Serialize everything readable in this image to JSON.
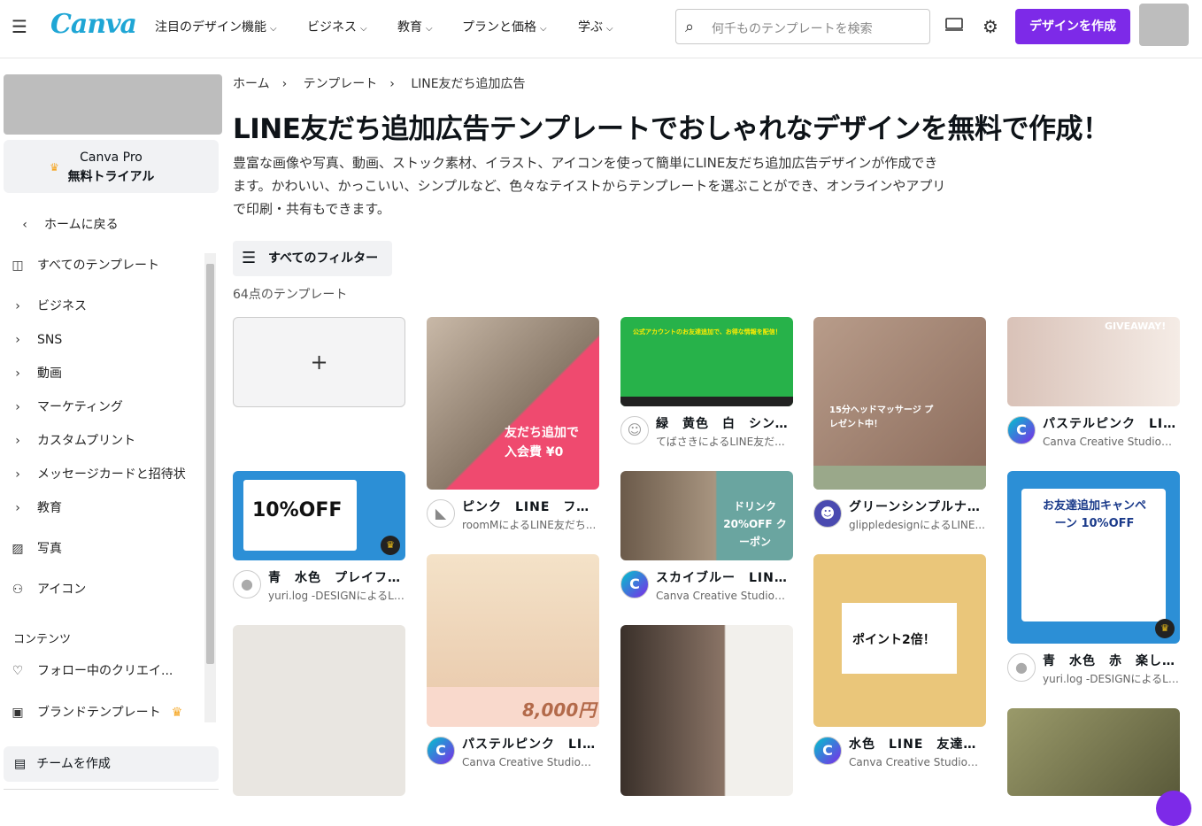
{
  "header": {
    "logo": "Canva",
    "nav": [
      "注目のデザイン機能",
      "ビジネス",
      "教育",
      "プランと価格",
      "学ぶ"
    ],
    "search_placeholder": "何千ものテンプレートを検索",
    "create_label": "デザインを作成"
  },
  "sidebar": {
    "pro_line1": "Canva Pro",
    "pro_line2": "無料トライアル",
    "back": "ホームに戻る",
    "all_templates": "すべてのテンプレート",
    "categories": [
      "ビジネス",
      "SNS",
      "動画",
      "マーケティング",
      "カスタムプリント",
      "メッセージカードと招待状",
      "教育"
    ],
    "photos": "写真",
    "icons": "アイコン",
    "section": "コンテンツ",
    "following": "フォロー中のクリエイ...",
    "brand": "ブランドテンプレート",
    "team": "チームを作成"
  },
  "breadcrumb": [
    "ホーム",
    "テンプレート",
    "LINE友だち追加広告"
  ],
  "page": {
    "title": "LINE友だち追加広告テンプレートでおしゃれなデザインを無料で作成！",
    "description": "豊富な画像や写真、動画、ストック素材、イラスト、アイコンを使って簡単にLINE友だち追加広告デザインが作成できます。かわいい、かっこいい、シンプルなど、色々なテイストからテンプレートを選ぶことができ、オンラインやアプリで印刷・共有もできます。",
    "filter_label": "すべてのフィルター",
    "count": "64点のテンプレート",
    "blank_symbol": "+"
  },
  "templates": [
    {
      "title": "青　水色　プレイフル...",
      "author": "yuri.log -DESIGNによるLI...",
      "thumb_text": "10%OFF"
    },
    {
      "title": "ピンク　LINE　フィッ...",
      "author": "roomMによるLINE友だち...",
      "thumb_text": "友だち追加で 入会費 ¥0"
    },
    {
      "title": "パステルピンク　LINE...",
      "author": "Canva Creative Studioに...",
      "thumb_text": "8,000円"
    },
    {
      "title": "緑　黄色　白　シンプ...",
      "author": "てばさきによるLINE友だ...",
      "thumb_text": "公式アカウントのお友達追加で、お得な情報を配信！"
    },
    {
      "title": "スカイブルー　LINE　...",
      "author": "Canva Creative Studioに...",
      "thumb_text": "ドリンク 20%OFF クーポン"
    },
    {
      "title": "グリーンシンプルナチ...",
      "author": "glippledesignによるLINE...",
      "thumb_text": "15分ヘッドマッサージ プレゼント中！"
    },
    {
      "title": "水色　LINE　友達追加...",
      "author": "Canva Creative Studioに...",
      "thumb_text": "ポイント2倍！"
    },
    {
      "title": "パステルピンク　LINE...",
      "author": "Canva Creative Studioに...",
      "thumb_text": "GIVEAWAY!"
    },
    {
      "title": "青　水色　赤　楽しい...",
      "author": "yuri.log -DESIGNによるLI...",
      "thumb_text": "お友達追加キャンペーン 10%OFF"
    }
  ],
  "colors": {
    "accent": "#7d2ae8",
    "logo": "#1fa6d5"
  }
}
